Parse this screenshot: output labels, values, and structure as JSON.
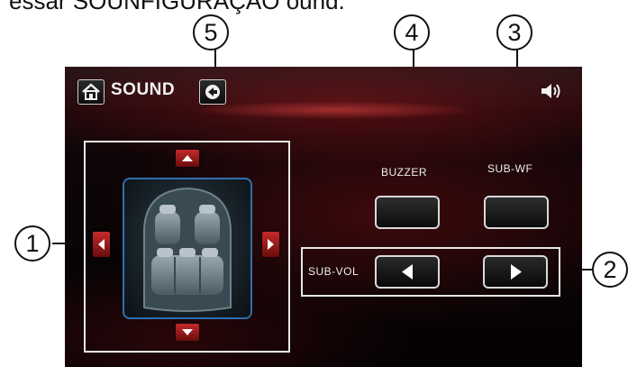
{
  "caption": "essar SOUNFIGURAÇÃO ound.",
  "header": {
    "title": "SOUND"
  },
  "callouts": [
    "1",
    "2",
    "3",
    "4",
    "5"
  ],
  "labels": {
    "buzzer": "BUZZER",
    "subwf": "SUB-WF",
    "subvol": "SUB-VOL"
  },
  "icons": {
    "home": "home-icon",
    "back": "back-icon",
    "volume": "speaker-volume-icon",
    "up": "triangle-up-icon",
    "down": "triangle-down-icon",
    "left": "triangle-left-icon",
    "right": "triangle-right-icon",
    "seat": "car-seat-layout-icon"
  },
  "colors": {
    "panel_border": "#e6e6e6",
    "arrow_red": "#c42a2a",
    "seat_border": "#2f6fae"
  }
}
